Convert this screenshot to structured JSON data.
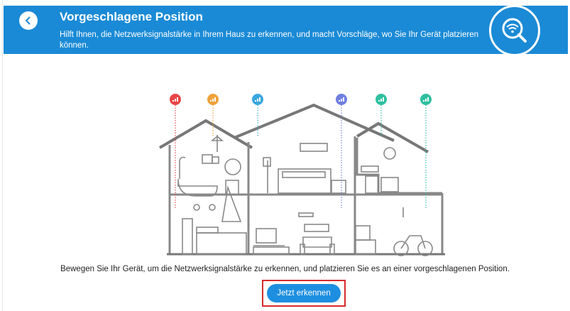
{
  "header": {
    "title": "Vorgeschlagene Position",
    "subtitle": "Hilft Ihnen, die Netzwerksignalstärke in Ihrem Haus zu erkennen, und macht Vorschläge, wo Sie Ihr Gerät platzieren können.",
    "back_icon": "chevron-left-icon",
    "badge_icon": "wifi-search-icon",
    "color": "#1a8ad6"
  },
  "illustration": {
    "signal_pins": [
      {
        "color": "#e84545"
      },
      {
        "color": "#f0a23a"
      },
      {
        "color": "#3aa7e0"
      },
      {
        "color": "#6f7fe0"
      },
      {
        "color": "#2fbfa0"
      },
      {
        "color": "#2fbfa0"
      }
    ]
  },
  "main": {
    "instruction": "Bewegen Sie Ihr Gerät, um die Netzwerksignalstärke zu erkennen, und platzieren Sie es an einer vorgeschlagenen Position.",
    "detect_button_label": "Jetzt erkennen",
    "button_color": "#1e8fe0",
    "highlight_color": "#d82a2a"
  }
}
